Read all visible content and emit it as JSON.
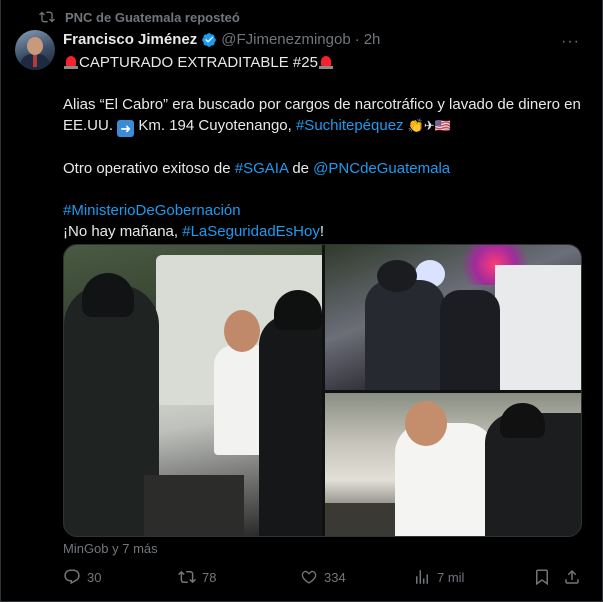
{
  "repost": {
    "text": "PNC de Guatemala reposteó"
  },
  "author": {
    "name": "Francisco Jiménez",
    "handle": "@FJimenezmingob",
    "dot": "·",
    "time": "2h"
  },
  "post": {
    "headline": "CAPTURADO EXTRADITABLE #25",
    "line1": "Alias “El Cabro” era buscado por cargos de narcotráfico y lavado de dinero en EE.UU.",
    "line1_after": "Km. 194 Cuyotenango,",
    "tag_suchi": "#Suchitepéquez",
    "line2_pre": "Otro operativo exitoso de",
    "tag_sgaia": "#SGAIA",
    "line2_mid": "de",
    "mention_pnc": "@PNCdeGuatemala",
    "tag_ministerio": "#MinisterioDeGobernación",
    "line4_pre": "¡No hay mañana,",
    "tag_seguridad": "#LaSeguridadEsHoy",
    "line4_post": "!"
  },
  "media": {
    "caption": "MinGob y 7 más"
  },
  "actions": {
    "replies": "30",
    "reposts": "78",
    "likes": "334",
    "views": "7 mil"
  },
  "colors": {
    "link": "#1d9bf0",
    "muted": "#71767b",
    "verified": "#1d9bf0"
  }
}
